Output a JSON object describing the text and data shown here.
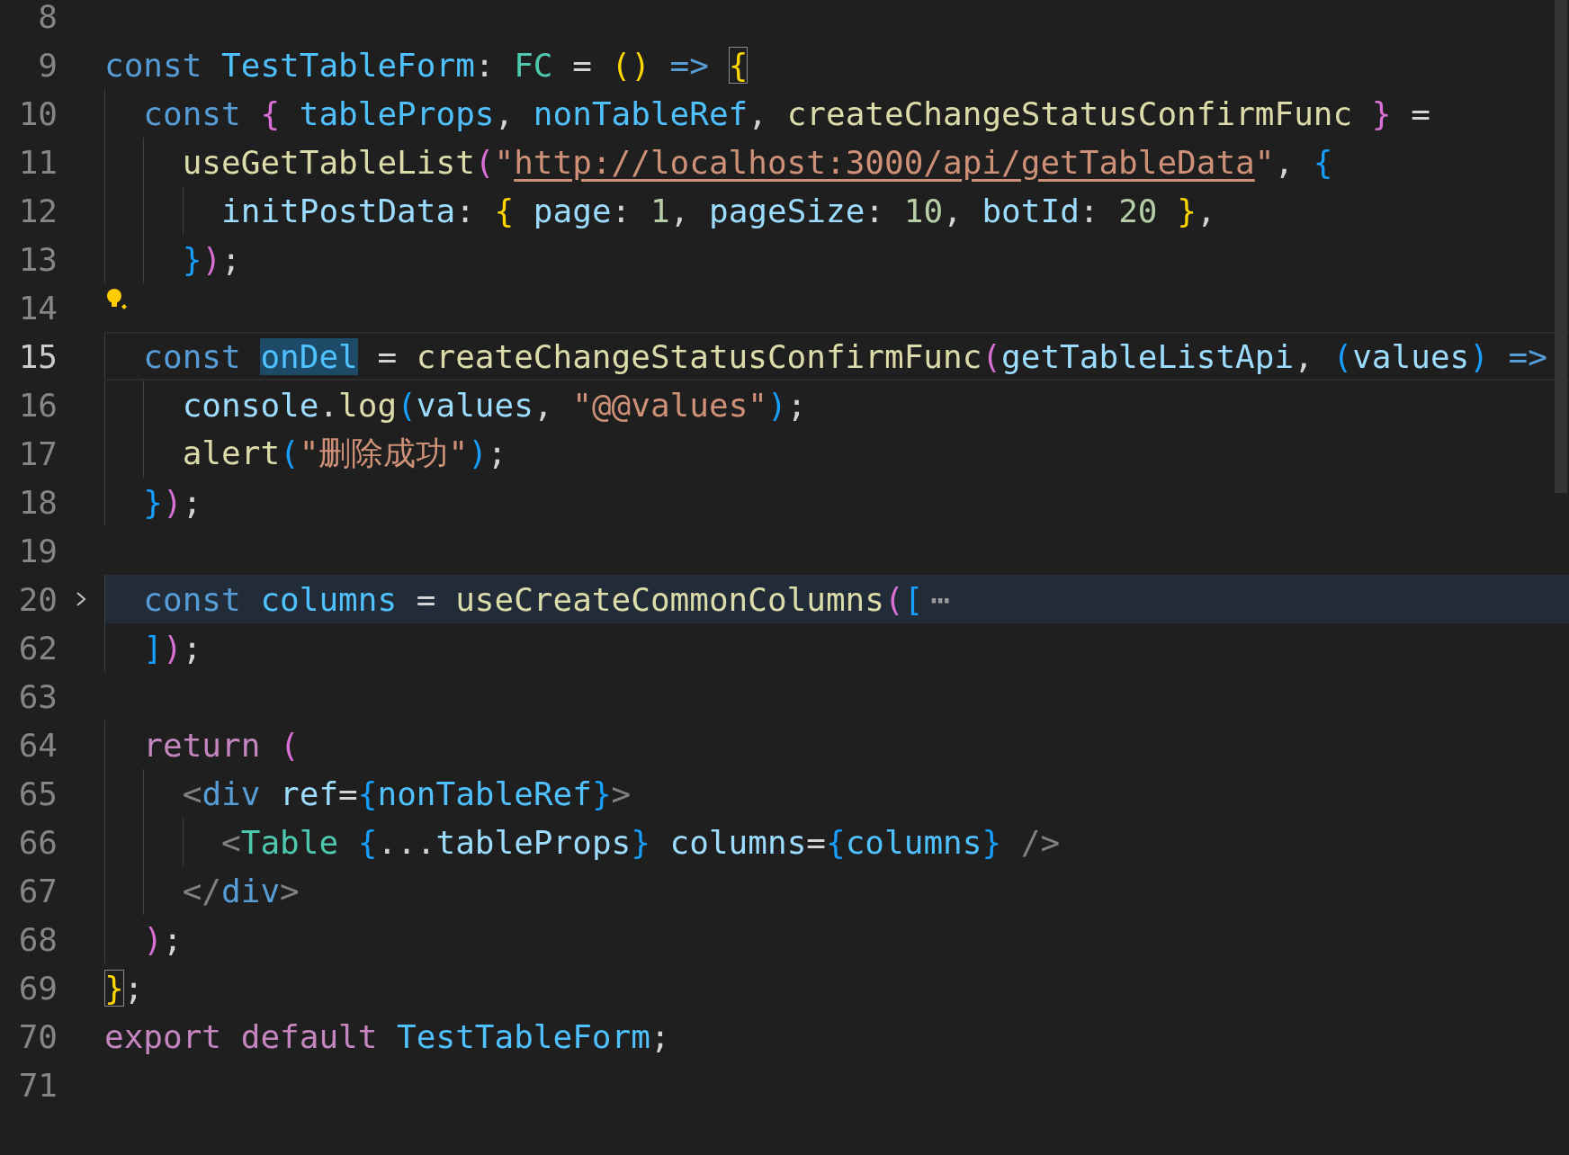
{
  "editor": {
    "lines": [
      {
        "number": "8",
        "current": false,
        "folded": false,
        "lightbulb": false
      },
      {
        "number": "9",
        "current": false,
        "folded": false,
        "lightbulb": false,
        "tokens": [
          {
            "text": "const ",
            "kind": "kw"
          },
          {
            "text": "TestTableForm",
            "kind": "cvar"
          },
          {
            "text": ": ",
            "kind": "op"
          },
          {
            "text": "FC",
            "kind": "type"
          },
          {
            "text": " = ",
            "kind": "op"
          },
          {
            "text": "() ",
            "kind": "b1"
          },
          {
            "text": "=> ",
            "kind": "kw"
          },
          {
            "text": "{",
            "kind": "b1",
            "matched": true
          }
        ]
      },
      {
        "number": "10",
        "current": false,
        "folded": false,
        "lightbulb": false,
        "tokens": [
          {
            "text": "  const ",
            "kind": "kw"
          },
          {
            "text": "{ ",
            "kind": "b2"
          },
          {
            "text": "tableProps",
            "kind": "cvar"
          },
          {
            "text": ", ",
            "kind": "op"
          },
          {
            "text": "nonTableRef",
            "kind": "cvar"
          },
          {
            "text": ", ",
            "kind": "op"
          },
          {
            "text": "createChangeStatusConfirmFunc ",
            "kind": "fn"
          },
          {
            "text": "}",
            "kind": "b2"
          },
          {
            "text": " =",
            "kind": "op"
          }
        ]
      },
      {
        "number": "11",
        "current": false,
        "folded": false,
        "lightbulb": false,
        "tokens": [
          {
            "text": "    useGetTableList",
            "kind": "fn"
          },
          {
            "text": "(",
            "kind": "b2"
          },
          {
            "text": "\"",
            "kind": "str"
          },
          {
            "text": "http://localhost:3000/api/getTableData",
            "kind": "str",
            "link": true
          },
          {
            "text": "\"",
            "kind": "str"
          },
          {
            "text": ", ",
            "kind": "op"
          },
          {
            "text": "{",
            "kind": "b3"
          }
        ]
      },
      {
        "number": "12",
        "current": false,
        "folded": false,
        "lightbulb": false,
        "tokens": [
          {
            "text": "      initPostData",
            "kind": "var"
          },
          {
            "text": ": ",
            "kind": "op"
          },
          {
            "text": "{ ",
            "kind": "b1"
          },
          {
            "text": "page",
            "kind": "var"
          },
          {
            "text": ": ",
            "kind": "op"
          },
          {
            "text": "1",
            "kind": "num"
          },
          {
            "text": ", ",
            "kind": "op"
          },
          {
            "text": "pageSize",
            "kind": "var"
          },
          {
            "text": ": ",
            "kind": "op"
          },
          {
            "text": "10",
            "kind": "num"
          },
          {
            "text": ", ",
            "kind": "op"
          },
          {
            "text": "botId",
            "kind": "var"
          },
          {
            "text": ": ",
            "kind": "op"
          },
          {
            "text": "20 ",
            "kind": "num"
          },
          {
            "text": "}",
            "kind": "b1"
          },
          {
            "text": ",",
            "kind": "op"
          }
        ]
      },
      {
        "number": "13",
        "current": false,
        "folded": false,
        "lightbulb": false,
        "tokens": [
          {
            "text": "    }",
            "kind": "b3"
          },
          {
            "text": ")",
            "kind": "b2"
          },
          {
            "text": ";",
            "kind": "op"
          }
        ]
      },
      {
        "number": "14",
        "current": false,
        "folded": false,
        "lightbulb": true
      },
      {
        "number": "15",
        "current": true,
        "folded": false,
        "lightbulb": false,
        "tokens": [
          {
            "text": "  const ",
            "kind": "kw"
          },
          {
            "text": "onDel",
            "kind": "cvar",
            "highlighted": true
          },
          {
            "text": " = ",
            "kind": "op"
          },
          {
            "text": "createChangeStatusConfirmFunc",
            "kind": "fn"
          },
          {
            "text": "(",
            "kind": "b2"
          },
          {
            "text": "getTableListApi",
            "kind": "var"
          },
          {
            "text": ", ",
            "kind": "op"
          },
          {
            "text": "(",
            "kind": "b3"
          },
          {
            "text": "values",
            "kind": "var"
          },
          {
            "text": ") ",
            "kind": "b3"
          },
          {
            "text": "=>",
            "kind": "kw"
          }
        ]
      },
      {
        "number": "16",
        "current": false,
        "folded": false,
        "lightbulb": false,
        "tokens": [
          {
            "text": "    console",
            "kind": "var"
          },
          {
            "text": ".",
            "kind": "op"
          },
          {
            "text": "log",
            "kind": "fn"
          },
          {
            "text": "(",
            "kind": "b3"
          },
          {
            "text": "values",
            "kind": "var"
          },
          {
            "text": ", ",
            "kind": "op"
          },
          {
            "text": "\"@@values\"",
            "kind": "str"
          },
          {
            "text": ")",
            "kind": "b3"
          },
          {
            "text": ";",
            "kind": "op"
          }
        ]
      },
      {
        "number": "17",
        "current": false,
        "folded": false,
        "lightbulb": false,
        "tokens": [
          {
            "text": "    alert",
            "kind": "fn"
          },
          {
            "text": "(",
            "kind": "b3"
          },
          {
            "text": "\"删除成功\"",
            "kind": "str"
          },
          {
            "text": ")",
            "kind": "b3"
          },
          {
            "text": ";",
            "kind": "op"
          }
        ]
      },
      {
        "number": "18",
        "current": false,
        "folded": false,
        "lightbulb": false,
        "tokens": [
          {
            "text": "  }",
            "kind": "b3"
          },
          {
            "text": ")",
            "kind": "b2"
          },
          {
            "text": ";",
            "kind": "op"
          }
        ]
      },
      {
        "number": "19",
        "current": false,
        "folded": false,
        "lightbulb": false
      },
      {
        "number": "20",
        "current": false,
        "folded": true,
        "lightbulb": false,
        "tokens": [
          {
            "text": "  const ",
            "kind": "kw"
          },
          {
            "text": "columns",
            "kind": "cvar"
          },
          {
            "text": " = ",
            "kind": "op"
          },
          {
            "text": "useCreateCommonColumns",
            "kind": "fn"
          },
          {
            "text": "(",
            "kind": "b2"
          },
          {
            "text": "[",
            "kind": "b3"
          },
          {
            "text": "⋯",
            "kind": "fold"
          }
        ]
      },
      {
        "number": "62",
        "current": false,
        "folded": false,
        "lightbulb": false,
        "tokens": [
          {
            "text": "  ]",
            "kind": "b3"
          },
          {
            "text": ")",
            "kind": "b2"
          },
          {
            "text": ";",
            "kind": "op"
          }
        ]
      },
      {
        "number": "63",
        "current": false,
        "folded": false,
        "lightbulb": false
      },
      {
        "number": "64",
        "current": false,
        "folded": false,
        "lightbulb": false,
        "tokens": [
          {
            "text": "  return ",
            "kind": "ctrl"
          },
          {
            "text": "(",
            "kind": "b2"
          }
        ]
      },
      {
        "number": "65",
        "current": false,
        "folded": false,
        "lightbulb": false,
        "tokens": [
          {
            "text": "    <",
            "kind": "angle"
          },
          {
            "text": "div ",
            "kind": "kw"
          },
          {
            "text": "ref",
            "kind": "var"
          },
          {
            "text": "=",
            "kind": "op"
          },
          {
            "text": "{",
            "kind": "b3"
          },
          {
            "text": "nonTableRef",
            "kind": "cvar"
          },
          {
            "text": "}",
            "kind": "b3"
          },
          {
            "text": ">",
            "kind": "angle"
          }
        ]
      },
      {
        "number": "66",
        "current": false,
        "folded": false,
        "lightbulb": false,
        "tokens": [
          {
            "text": "      <",
            "kind": "angle"
          },
          {
            "text": "Table ",
            "kind": "type"
          },
          {
            "text": "{",
            "kind": "b3"
          },
          {
            "text": "...",
            "kind": "op"
          },
          {
            "text": "tableProps",
            "kind": "var"
          },
          {
            "text": "} ",
            "kind": "b3"
          },
          {
            "text": "columns",
            "kind": "var"
          },
          {
            "text": "=",
            "kind": "op"
          },
          {
            "text": "{",
            "kind": "b3"
          },
          {
            "text": "columns",
            "kind": "cvar"
          },
          {
            "text": "} ",
            "kind": "b3"
          },
          {
            "text": "/>",
            "kind": "angle"
          }
        ]
      },
      {
        "number": "67",
        "current": false,
        "folded": false,
        "lightbulb": false,
        "tokens": [
          {
            "text": "    </",
            "kind": "angle"
          },
          {
            "text": "div",
            "kind": "kw"
          },
          {
            "text": ">",
            "kind": "angle"
          }
        ]
      },
      {
        "number": "68",
        "current": false,
        "folded": false,
        "lightbulb": false,
        "tokens": [
          {
            "text": "  )",
            "kind": "b2"
          },
          {
            "text": ";",
            "kind": "op"
          }
        ]
      },
      {
        "number": "69",
        "current": false,
        "folded": false,
        "lightbulb": false,
        "tokens": [
          {
            "text": "}",
            "kind": "b1",
            "matched": true
          },
          {
            "text": ";",
            "kind": "op"
          }
        ]
      },
      {
        "number": "70",
        "current": false,
        "folded": false,
        "lightbulb": false,
        "tokens": [
          {
            "text": "export default ",
            "kind": "ctrl"
          },
          {
            "text": "TestTableForm",
            "kind": "cvar"
          },
          {
            "text": ";",
            "kind": "op"
          }
        ]
      },
      {
        "number": "71",
        "current": false,
        "folded": false,
        "lightbulb": false
      }
    ]
  }
}
